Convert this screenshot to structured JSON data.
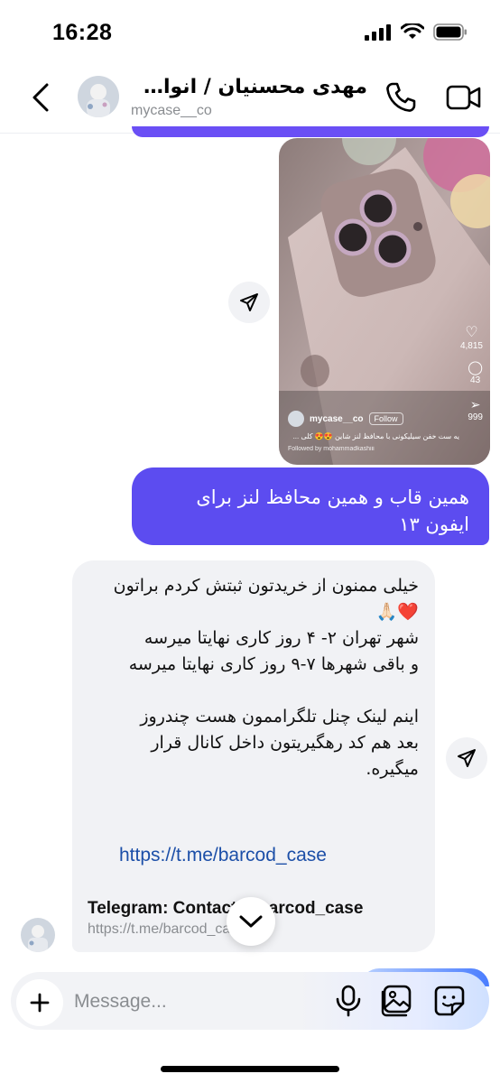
{
  "status_bar": {
    "time": "16:28"
  },
  "header": {
    "contact_name": "مهدی محسنیان / انواع قا...",
    "username": "mycase__co"
  },
  "reel": {
    "username": "mycase__co",
    "follow_label": "Follow",
    "caption": "یه ست خفن سیلیکونی با محافظ لنز شاین 😍😍 کلی ...",
    "followed_by": "Followed by mohammadkashiii",
    "likes": "4,815",
    "comments": "43",
    "shares": "999"
  },
  "messages": {
    "outgoing": "همین قاب و همین محافظ لنز برای ایفون ۱۳",
    "incoming_lines": [
      "خیلی ممنون از خریدتون ثبتش کردم براتون",
      "❤️🙏🏻",
      "شهر تهران ۲- ۴ روز کاری نهایتا میرسه",
      "و باقی شهرها ۷-۹ روز کاری نهایتا میرسه",
      "",
      "اینم لینک چنل تلگراممون هست چندروز",
      "بعد هم کد رهگیریتون داخل کانال قرار",
      "میگیره."
    ],
    "link": "https://t.me/barcod_case",
    "preview_title": "Telegram: Contact @barcod_case",
    "preview_url": "https://t.me/barcod_case"
  },
  "composer": {
    "placeholder": "Message..."
  },
  "colors": {
    "outgoing_bubble": "#5c4cf0",
    "incoming_bubble": "#f1f2f5",
    "link": "#1c4fa8"
  }
}
